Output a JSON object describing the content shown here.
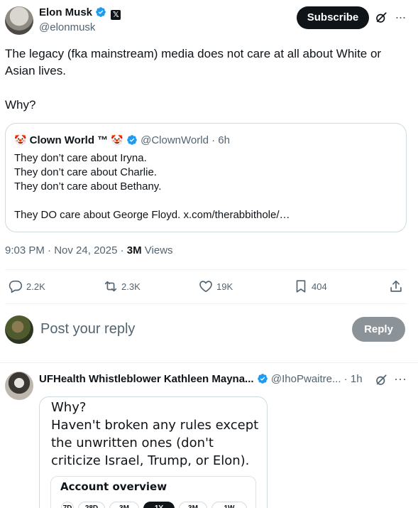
{
  "main_tweet": {
    "author_name": "Elon Musk",
    "author_handle": "@elonmusk",
    "affiliate_badge": "𝕏",
    "subscribe_label": "Subscribe",
    "more_glyph": "···",
    "text": "The legacy (fka mainstream) media does not care at all about White or Asian lives.\n\nWhy?",
    "meta": {
      "time": "9:03 PM",
      "sep1": " · ",
      "date": "Nov 24, 2025",
      "sep2": " · ",
      "views_count": "3M",
      "views_label": " Views"
    },
    "actions": {
      "replies": "2.2K",
      "reposts": "2.3K",
      "likes": "19K",
      "bookmarks": "404"
    }
  },
  "quoted_tweet": {
    "emoji_left": "🤡",
    "author_name": "Clown World ™",
    "emoji_right": "🤡",
    "author_handle": "@ClownWorld",
    "time_sep": " · ",
    "time": "6h",
    "text": "They don’t care about Iryna.\nThey don’t care about Charlie.\nThey don’t care about Bethany.\n\nThey DO care about George Floyd. x.com/therabbithole/…"
  },
  "reply_composer": {
    "placeholder": "Post your reply",
    "reply_label": "Reply"
  },
  "reply_tweet": {
    "author_name": "UFHealth Whistleblower Kathleen Mayna...",
    "author_handle": "@IhoPwaitre...",
    "time_sep": " · ",
    "time": "1h",
    "more_glyph": "···",
    "image_text": "Why?\nHaven't broken any rules except the unwritten ones (don't criticize Israel, Trump, or Elon).",
    "image_card_title": "Account overview",
    "image_chips": [
      "7D",
      "28D",
      "3M",
      "1Y",
      "3M",
      "1W"
    ]
  },
  "colors": {
    "text": "#0f1419",
    "secondary": "#536471",
    "verified_blue": "#1d9bf0",
    "border": "#cfd9de",
    "divider": "#eff3f4"
  }
}
